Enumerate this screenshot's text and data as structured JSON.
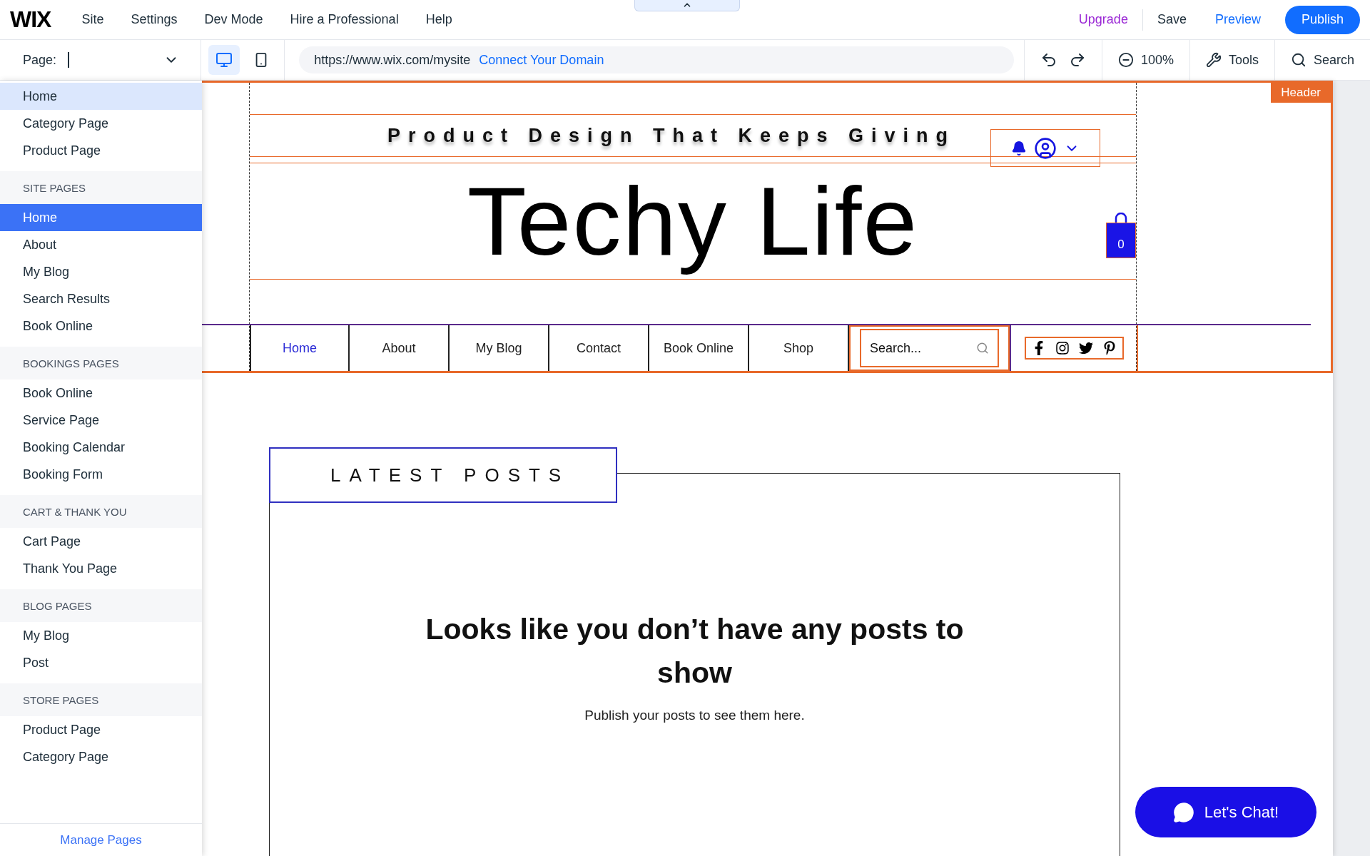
{
  "topbar": {
    "logo": "WIX",
    "menu": [
      "Site",
      "Settings",
      "Dev Mode",
      "Hire a Professional",
      "Help"
    ],
    "upgrade": "Upgrade",
    "save": "Save",
    "preview": "Preview",
    "publish": "Publish"
  },
  "toolbar": {
    "page_label": "Page:",
    "devices": [
      {
        "kind": "desktop",
        "selected": true
      },
      {
        "kind": "mobile",
        "selected": false
      }
    ],
    "url": "https://www.wix.com/mysite",
    "connect_domain": "Connect Your Domain",
    "zoom": "100%",
    "tools": "Tools",
    "search": "Search"
  },
  "pages_menu": {
    "groups": [
      {
        "items": [
          {
            "label": "Home",
            "selected": false,
            "hovered": true
          },
          {
            "label": "Category Page",
            "selected": false,
            "hovered": false
          },
          {
            "label": "Product Page",
            "selected": false,
            "hovered": false
          }
        ]
      },
      {
        "title": "SITE PAGES",
        "items": [
          {
            "label": "Home",
            "selected": true,
            "hovered": false
          },
          {
            "label": "About",
            "selected": false,
            "hovered": false
          },
          {
            "label": "My Blog",
            "selected": false,
            "hovered": false
          },
          {
            "label": "Search Results",
            "selected": false,
            "hovered": false
          },
          {
            "label": "Book Online",
            "selected": false,
            "hovered": false
          }
        ]
      },
      {
        "title": "BOOKINGS PAGES",
        "items": [
          {
            "label": "Book Online",
            "selected": false,
            "hovered": false
          },
          {
            "label": "Service Page",
            "selected": false,
            "hovered": false
          },
          {
            "label": "Booking Calendar",
            "selected": false,
            "hovered": false
          },
          {
            "label": "Booking Form",
            "selected": false,
            "hovered": false
          }
        ]
      },
      {
        "title": "CART & THANK YOU",
        "items": [
          {
            "label": "Cart Page",
            "selected": false,
            "hovered": false
          },
          {
            "label": "Thank You Page",
            "selected": false,
            "hovered": false
          }
        ]
      },
      {
        "title": "BLOG PAGES",
        "items": [
          {
            "label": "My Blog",
            "selected": false,
            "hovered": false
          },
          {
            "label": "Post",
            "selected": false,
            "hovered": false
          }
        ]
      },
      {
        "title": "STORE PAGES",
        "items": [
          {
            "label": "Product Page",
            "selected": false,
            "hovered": false
          },
          {
            "label": "Category Page",
            "selected": false,
            "hovered": false
          }
        ]
      }
    ],
    "manage_pages": "Manage Pages"
  },
  "site": {
    "header_tag": "Header",
    "tagline": "Product Design That Keeps Giving",
    "title": "Techy Life",
    "cart_count": "0",
    "nav": [
      {
        "label": "Home",
        "selected": true
      },
      {
        "label": "About",
        "selected": false
      },
      {
        "label": "My Blog",
        "selected": false
      },
      {
        "label": "Contact",
        "selected": false
      },
      {
        "label": "Book Online",
        "selected": false
      },
      {
        "label": "Shop",
        "selected": false
      }
    ],
    "search_placeholder": "Search...",
    "section_title": "LATEST POSTS",
    "empty_title": "Looks like you don’t have any posts to show",
    "empty_text": "Publish your posts to see them here.",
    "chat": "Let's Chat!"
  }
}
